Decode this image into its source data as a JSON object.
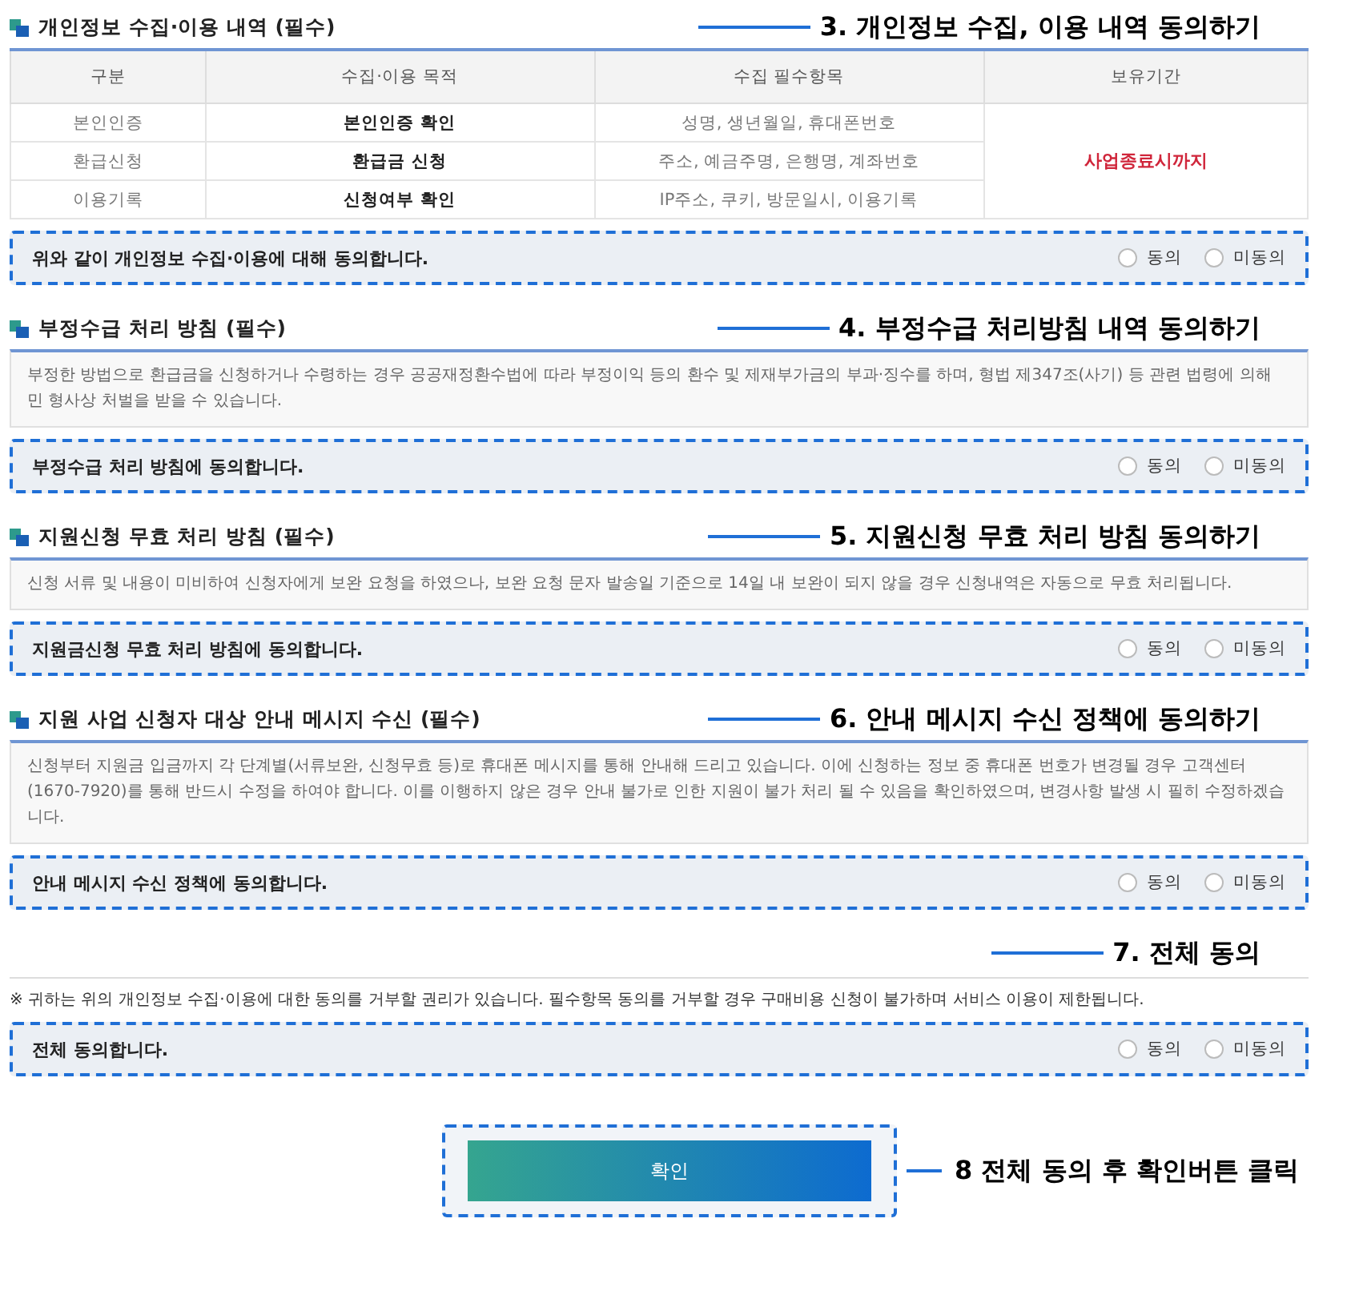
{
  "sections": [
    {
      "kind": "table",
      "title": "개인정보 수집·이용 내역 (필수)",
      "annotation": "3. 개인정보 수집, 이용 내역 동의하기",
      "table": {
        "columns": [
          "구분",
          "수집·이용 목적",
          "수집 필수항목",
          "보유기간"
        ],
        "rows": [
          {
            "cells": [
              "본인인증",
              "본인인증 확인",
              "성명, 생년월일, 휴대폰번호"
            ]
          },
          {
            "cells": [
              "환급신청",
              "환급금 신청",
              "주소, 예금주명, 은행명, 계좌번호"
            ]
          },
          {
            "cells": [
              "이용기록",
              "신청여부 확인",
              "IP주소, 쿠키, 방문일시, 이용기록"
            ]
          }
        ],
        "retention": "사업종료시까지"
      },
      "consent": {
        "label": "위와 같이 개인정보 수집·이용에 대해 동의합니다.",
        "options": [
          {
            "label": "동의",
            "selected": false
          },
          {
            "label": "미동의",
            "selected": false
          }
        ]
      }
    },
    {
      "kind": "text",
      "title": "부정수급 처리 방침 (필수)",
      "annotation": "4. 부정수급 처리방침 내역 동의하기",
      "description": "부정한 방법으로 환급금을 신청하거나 수령하는 경우 공공재정환수법에 따라 부정이익 등의 환수 및 제재부가금의 부과·징수를 하며, 형법 제347조(사기) 등 관련 법령에 의해 민 형사상 처벌을 받을 수 있습니다.",
      "consent": {
        "label": "부정수급 처리 방침에 동의합니다.",
        "options": [
          {
            "label": "동의",
            "selected": false
          },
          {
            "label": "미동의",
            "selected": false
          }
        ]
      }
    },
    {
      "kind": "text",
      "title": "지원신청 무효 처리 방침 (필수)",
      "annotation": "5. 지원신청 무효 처리 방침 동의하기",
      "description": "신청 서류 및 내용이 미비하여 신청자에게 보완 요청을 하였으나, 보완 요청 문자 발송일 기준으로 14일 내 보완이 되지 않을 경우 신청내역은 자동으로 무효 처리됩니다.",
      "consent": {
        "label": "지원금신청 무효 처리 방침에 동의합니다.",
        "options": [
          {
            "label": "동의",
            "selected": false
          },
          {
            "label": "미동의",
            "selected": false
          }
        ]
      }
    },
    {
      "kind": "text",
      "title": "지원 사업 신청자 대상 안내 메시지 수신 (필수)",
      "annotation": "6. 안내 메시지 수신 정책에 동의하기",
      "description": "신청부터 지원금 입금까지 각 단계별(서류보완, 신청무효 등)로 휴대폰 메시지를 통해 안내해 드리고 있습니다. 이에 신청하는 정보 중 휴대폰 번호가 변경될 경우 고객센터(1670-7920)를 통해 반드시 수정을 하여야 합니다. 이를 이행하지 않은 경우 안내 불가로 인한 지원이 불가 처리 될 수 있음을 확인하였으며, 변경사항 발생 시 필히 수정하겠습니다.",
      "consent": {
        "label": "안내 메시지 수신 정책에 동의합니다.",
        "options": [
          {
            "label": "동의",
            "selected": false
          },
          {
            "label": "미동의",
            "selected": false
          }
        ]
      }
    }
  ],
  "all": {
    "annotation": "7. 전체 동의",
    "notice": "※ 귀하는 위의 개인정보 수집·이용에 대한 동의를 거부할 권리가 있습니다. 필수항목 동의를 거부할 경우 구매비용 신청이 불가하며 서비스 이용이 제한됩니다.",
    "consent": {
      "label": "전체 동의합니다.",
      "options": [
        {
          "label": "동의",
          "selected": false
        },
        {
          "label": "미동의",
          "selected": false
        }
      ]
    }
  },
  "confirm": {
    "label": "확인",
    "annotation": "8 전체 동의 후 확인버튼 클릭"
  }
}
